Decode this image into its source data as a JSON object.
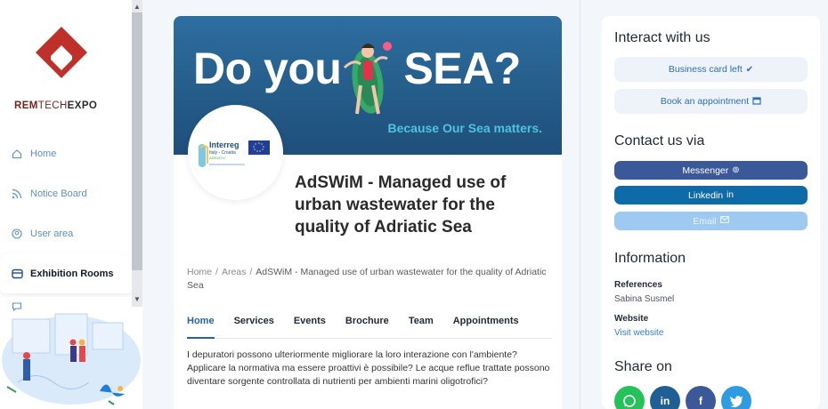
{
  "sidebar": {
    "logo": {
      "brand_part1": "REM",
      "brand_part2": "TECH",
      "brand_part3": "EXPO",
      "accent_color": "#c0302b"
    },
    "items": [
      {
        "label": "Home",
        "icon": "home-icon"
      },
      {
        "label": "Notice Board",
        "icon": "rss-icon"
      },
      {
        "label": "User area",
        "icon": "user-circle-icon"
      },
      {
        "label": "Exhibition Rooms",
        "icon": "exhibition-icon",
        "active": true
      },
      {
        "label": "Chat",
        "icon": "chat-icon"
      }
    ]
  },
  "banner": {
    "title_part1": "Do you",
    "title_part2": "SEA?",
    "subtitle": "Because Our Sea matters.",
    "accent_color": "#4ec3e0"
  },
  "org_logo": {
    "name_line1": "Interreg",
    "name_line2": "Italy - Croatia",
    "name_line3": "ADRIATIC"
  },
  "project": {
    "title": "AdSWiM - Managed use of urban wastewater for the quality of Adriatic Sea"
  },
  "breadcrumb": {
    "home": "Home",
    "areas": "Areas",
    "current": "AdSWiM - Managed use of urban wastewater for the quality of Adriatic Sea"
  },
  "tabs": [
    {
      "label": "Home",
      "active": true
    },
    {
      "label": "Services"
    },
    {
      "label": "Events"
    },
    {
      "label": "Brochure"
    },
    {
      "label": "Team"
    },
    {
      "label": "Appointments"
    }
  ],
  "description": "I depuratori possono ulteriormente migliorare la loro interazione con l'ambiente? Applicare la normativa ma essere proattivi è possibile? Le acque reflue trattate possono diventare sorgente controllata di nutrienti per ambienti marini oligotrofici?",
  "right_panel": {
    "interact_title": "Interact with us",
    "business_card": "Business card left",
    "business_card_icon": "check-icon",
    "appointment": "Book an appointment",
    "appointment_icon": "calendar-icon",
    "contact_title": "Contact us via",
    "messenger": "Messenger",
    "linkedin": "Linkedin",
    "email": "Email",
    "information_title": "Information",
    "references_label": "References",
    "references_value": "Sabina Susmel",
    "website_label": "Website",
    "website_link": "Visit website",
    "share_title": "Share on",
    "share": [
      {
        "icon": "whatsapp-icon",
        "color": "#25c25a"
      },
      {
        "icon": "linkedin-icon",
        "color": "#1f5f93",
        "glyph": "in"
      },
      {
        "icon": "facebook-icon",
        "color": "#3b5998",
        "glyph": "f"
      },
      {
        "icon": "twitter-icon",
        "color": "#2f9be0"
      }
    ],
    "colors": {
      "messenger": "#3b5998",
      "linkedin": "#0f6aa8",
      "email_bg": "#9ec9f1"
    }
  }
}
